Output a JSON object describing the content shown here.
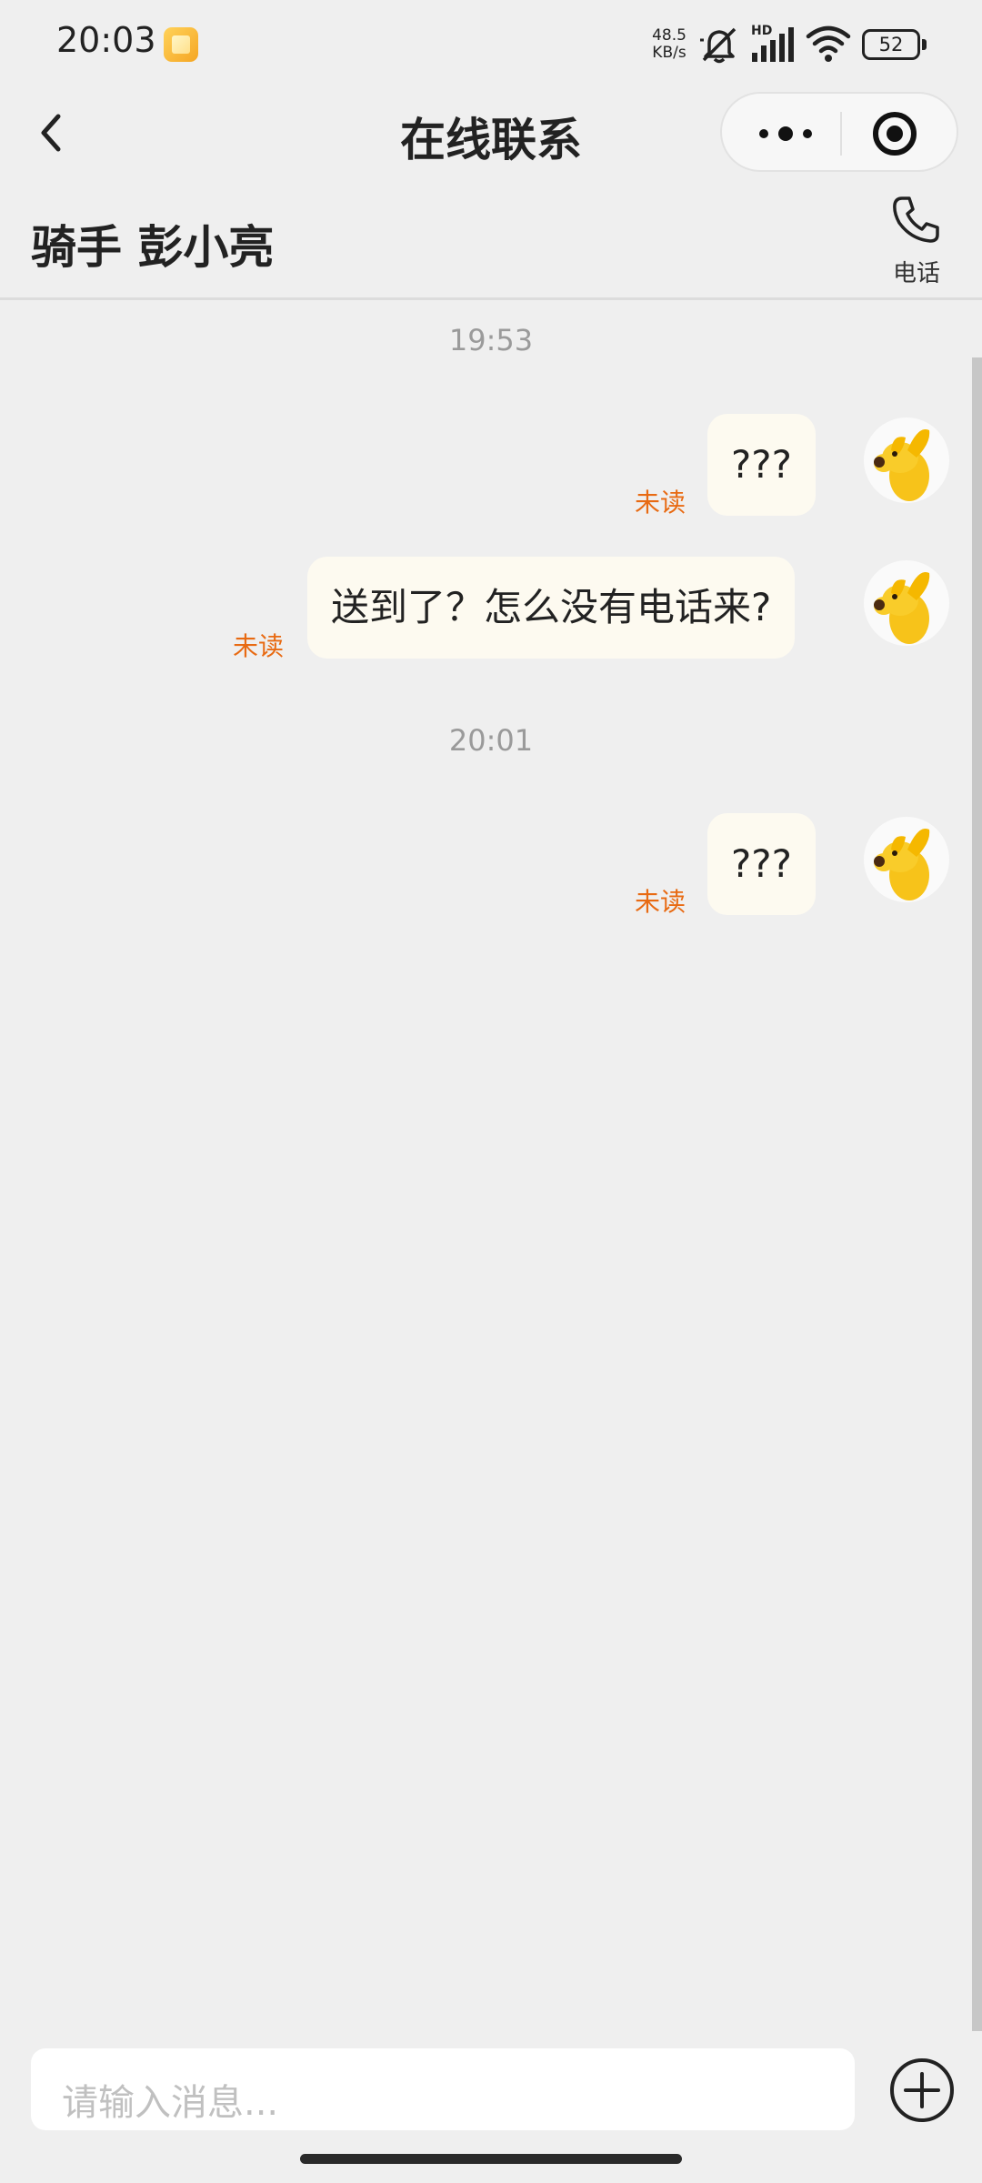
{
  "status_bar": {
    "time": "20:03",
    "net_speed_value": "48.5",
    "net_speed_unit": "KB/s",
    "signal_label": "HD",
    "battery": "52",
    "icons": [
      "app-notification-icon",
      "mute-icon",
      "signal-icon",
      "wifi-icon",
      "battery-icon"
    ]
  },
  "nav": {
    "title": "在线联系",
    "back_icon": "chevron-left-icon",
    "more_icon": "more-dots-icon",
    "close_icon": "target-circle-icon"
  },
  "rider": {
    "name": "骑手 彭小亮",
    "call_label": "电话",
    "call_icon": "phone-icon"
  },
  "chat": {
    "messages": [
      {
        "time": "19:53",
        "text": "???",
        "status": "未读"
      },
      {
        "text": "送到了？怎么没有电话来?",
        "status": "未读"
      },
      {
        "time": "20:01",
        "text": "???",
        "status": "未读"
      }
    ]
  },
  "input": {
    "placeholder": "请输入消息...",
    "plus_icon": "plus-circle-icon"
  },
  "colors": {
    "background": "#efefef",
    "bubble": "#fdfaf0",
    "unread": "#e86a12",
    "avatar_dog": "#f7c31a"
  }
}
